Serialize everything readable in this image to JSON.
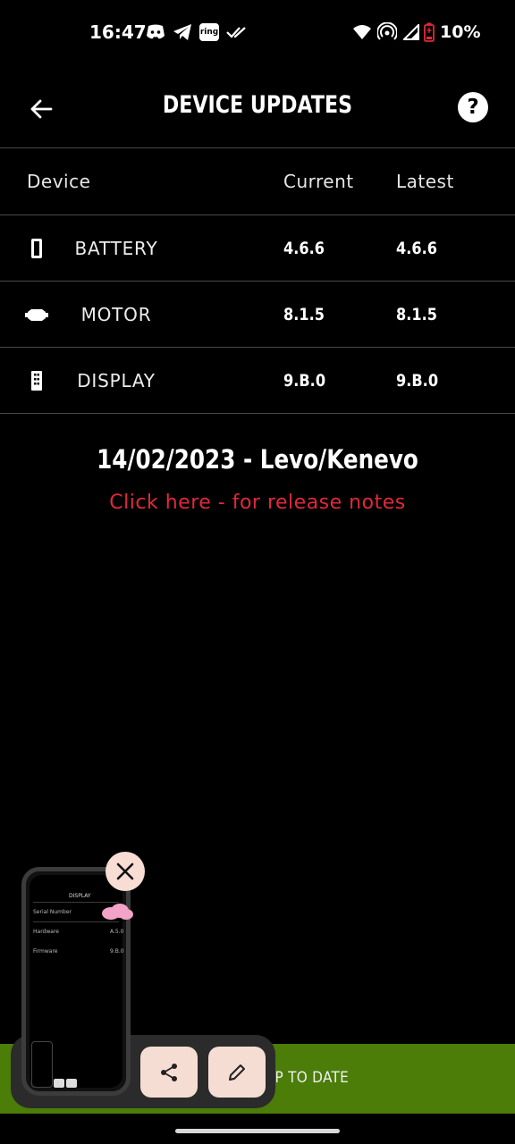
{
  "status_bar": {
    "time": "16:47",
    "notification_icons": [
      "discord-icon",
      "telegram-icon",
      "ring-icon",
      "double-check-icon"
    ],
    "ring_label": "ring",
    "system_icons": [
      "wifi-icon",
      "hotspot-icon",
      "signal-icon",
      "battery-low-icon"
    ],
    "battery_percent": "10%"
  },
  "header": {
    "title": "DEVICE UPDATES",
    "back_icon": "arrow-left-icon",
    "help_label": "?"
  },
  "table": {
    "columns": [
      "Device",
      "Current",
      "Latest"
    ],
    "rows": [
      {
        "icon": "battery-icon",
        "name": "BATTERY",
        "current": "4.6.6",
        "latest": "4.6.6"
      },
      {
        "icon": "motor-icon",
        "name": "MOTOR",
        "current": "8.1.5",
        "latest": "8.1.5"
      },
      {
        "icon": "display-icon",
        "name": "DISPLAY",
        "current": "9.B.0",
        "latest": "9.B.0"
      }
    ]
  },
  "release": {
    "date_line": "14/02/2023 - Levo/Kenevo",
    "link_text": "Click here - for release notes"
  },
  "bottom_bar": {
    "text": "UP TO DATE",
    "color": "#4b7d08"
  },
  "screenshot_overlay": {
    "thumb_title": "DISPLAY",
    "thumb_rows": [
      {
        "label": "Serial Number",
        "value": ""
      },
      {
        "label": "Hardware",
        "value": "A.5.0"
      },
      {
        "label": "Firmware",
        "value": "9.B.0"
      }
    ],
    "actions": [
      "share-icon",
      "edit-icon"
    ],
    "close_icon": "close-icon"
  },
  "colors": {
    "background": "#000000",
    "accent_red": "#e0283a",
    "overlay_button": "#f6ddd3"
  }
}
